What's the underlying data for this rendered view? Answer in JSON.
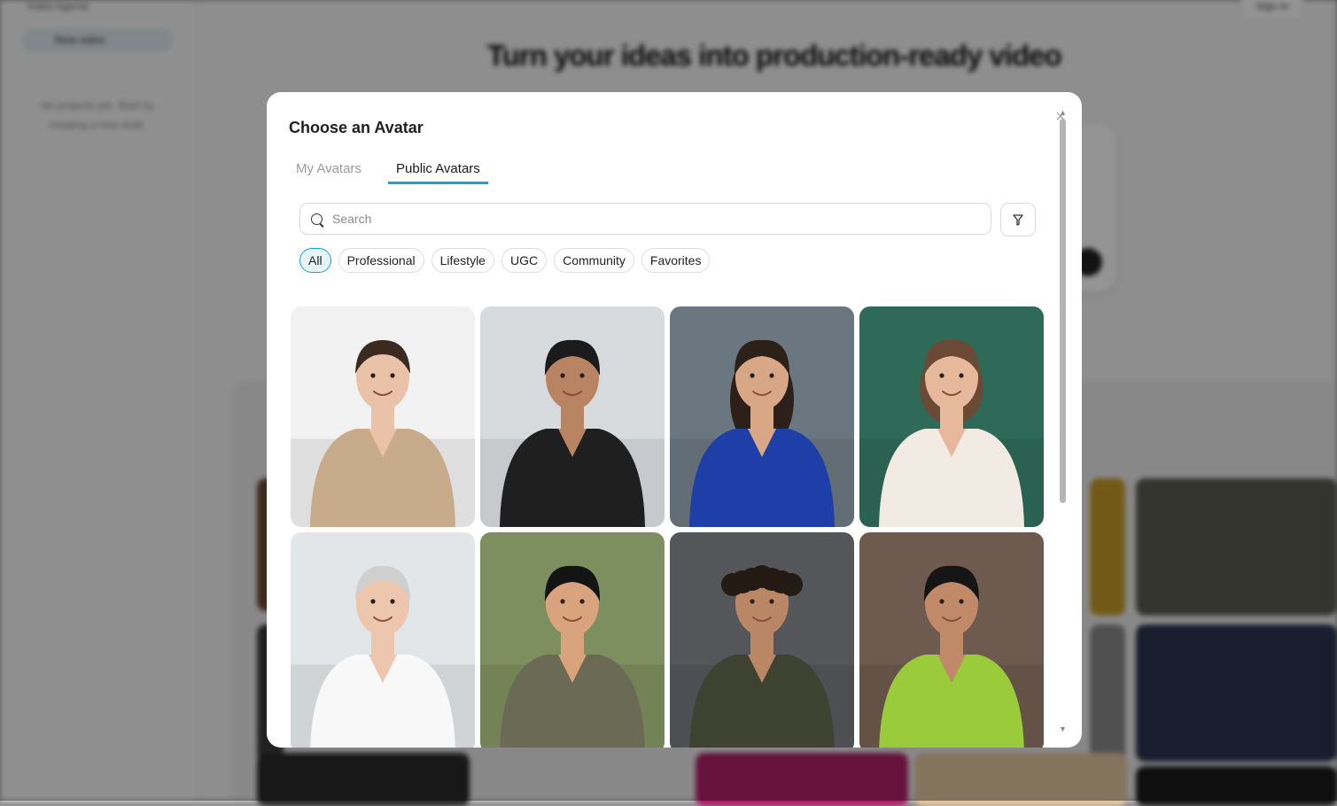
{
  "background": {
    "sidebar_title": "Video Agents",
    "sidebar_button": "New video",
    "sidebar_note": "No projects yet. Start by creating a new draft.",
    "top_button": "Sign in",
    "heading": "Turn your ideas into production-ready video"
  },
  "modal": {
    "title": "Choose an Avatar",
    "close_icon": "close-icon",
    "tabs": [
      {
        "label": "My Avatars",
        "active": false
      },
      {
        "label": "Public Avatars",
        "active": true
      }
    ],
    "search": {
      "placeholder": "Search",
      "value": ""
    },
    "filter_icon": "filter-icon",
    "chips": [
      {
        "label": "All",
        "active": true
      },
      {
        "label": "Professional",
        "active": false
      },
      {
        "label": "Lifestyle",
        "active": false
      },
      {
        "label": "UGC",
        "active": false
      },
      {
        "label": "Community",
        "active": false
      },
      {
        "label": "Favorites",
        "active": false
      }
    ],
    "avatars": [
      {
        "name": "avatar-woman-beige-blazer",
        "bg": "#f2f2f2",
        "skin": "#e9c2a8",
        "hair": "#3a2a20",
        "cloth": "#c8ab8a",
        "hairStyle": "bun"
      },
      {
        "name": "avatar-man-black-suit",
        "bg": "#d8dbde",
        "skin": "#b98462",
        "hair": "#1b1b1b",
        "cloth": "#1f1f1f",
        "hairStyle": "short"
      },
      {
        "name": "avatar-woman-blue-blouse",
        "bg": "#6b7780",
        "skin": "#d8a886",
        "hair": "#2c2018",
        "cloth": "#1f3fa8",
        "hairStyle": "long"
      },
      {
        "name": "avatar-woman-chalkboard",
        "bg": "#2f6a58",
        "skin": "#e6b99c",
        "hair": "#6a4a35",
        "cloth": "#f1ebe4",
        "hairStyle": "bob"
      },
      {
        "name": "avatar-older-woman-glasses",
        "bg": "#e3e6e8",
        "skin": "#ecc6ad",
        "hair": "#cfcfcf",
        "cloth": "#f8f8f8",
        "hairStyle": "bun"
      },
      {
        "name": "avatar-man-laptop-outdoor",
        "bg": "#7d8f5e",
        "skin": "#d9a47d",
        "hair": "#141414",
        "cloth": "#6b6a55",
        "hairStyle": "short"
      },
      {
        "name": "avatar-man-podcast-mic",
        "bg": "#55565a",
        "skin": "#b98766",
        "hair": "#241a14",
        "cloth": "#3e4230",
        "hairStyle": "curly"
      },
      {
        "name": "avatar-man-green-shirt",
        "bg": "#6e5a4e",
        "skin": "#c08a68",
        "hair": "#151515",
        "cloth": "#9acb3a",
        "hairStyle": "short"
      }
    ]
  }
}
